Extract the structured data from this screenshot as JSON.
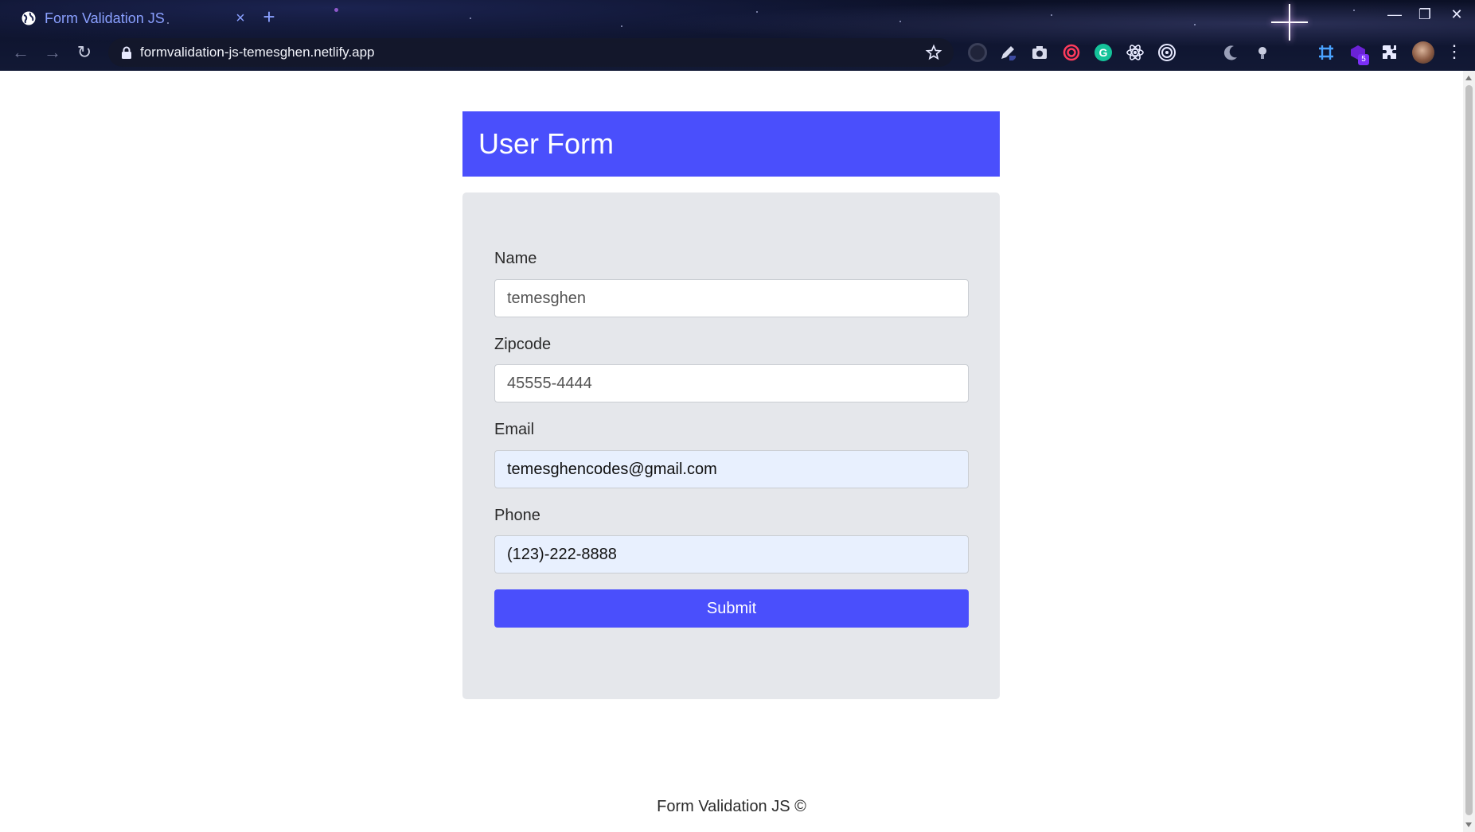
{
  "browser": {
    "tab_title": "Form Validation JS",
    "tab_close": "×",
    "new_tab": "+",
    "url": "formvalidation-js-temesghen.netlify.app",
    "extension_badge": "5",
    "window_controls": {
      "minimize": "—",
      "restore": "❐",
      "close": "✕"
    },
    "nav": {
      "back": "←",
      "forward": "→",
      "reload": "↻"
    },
    "menu": "⋮"
  },
  "form": {
    "title": "User Form",
    "fields": [
      {
        "label": "Name",
        "value": "temesghen",
        "autofill": false
      },
      {
        "label": "Zipcode",
        "value": "45555-4444",
        "autofill": false
      },
      {
        "label": "Email",
        "value": "temesghencodes@gmail.com",
        "autofill": true
      },
      {
        "label": "Phone",
        "value": "(123)-222-8888",
        "autofill": true
      }
    ],
    "submit_label": "Submit"
  },
  "footer": {
    "text": "Form Validation JS ©"
  },
  "colors": {
    "accent": "#4a4ffc",
    "card_bg": "#e5e7eb",
    "autofill_bg": "#e8f0fe"
  }
}
